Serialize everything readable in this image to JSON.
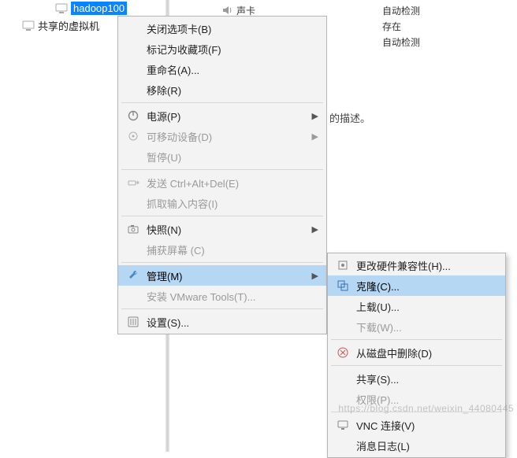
{
  "sidebar": {
    "selected": "hadoop100",
    "shared_vm": "共享的虚拟机"
  },
  "hw": {
    "sound": "声卡",
    "auto1": "自动检测",
    "exists": "存在",
    "auto2": "自动检测"
  },
  "desc": "的描述。",
  "menu": {
    "close_tab": "关闭选项卡(B)",
    "favorite": "标记为收藏项(F)",
    "rename": "重命名(A)...",
    "remove": "移除(R)",
    "power": "电源(P)",
    "removable": "可移动设备(D)",
    "pause": "暂停(U)",
    "send_cad": "发送 Ctrl+Alt+Del(E)",
    "grab_input": "抓取输入内容(I)",
    "snapshot": "快照(N)",
    "capture": "捕获屏幕 (C)",
    "manage": "管理(M)",
    "install_tools": "安装 VMware Tools(T)...",
    "settings": "设置(S)..."
  },
  "submenu": {
    "change_hw": "更改硬件兼容性(H)...",
    "clone": "克隆(C)...",
    "upload": "上载(U)...",
    "download": "下载(W)...",
    "delete_disk": "从磁盘中删除(D)",
    "share": "共享(S)...",
    "perm": "权限(P)...",
    "vnc": "VNC 连接(V)",
    "msglog": "消息日志(L)"
  },
  "watermark": "https://blog.csdn.net/weixin_44080445"
}
